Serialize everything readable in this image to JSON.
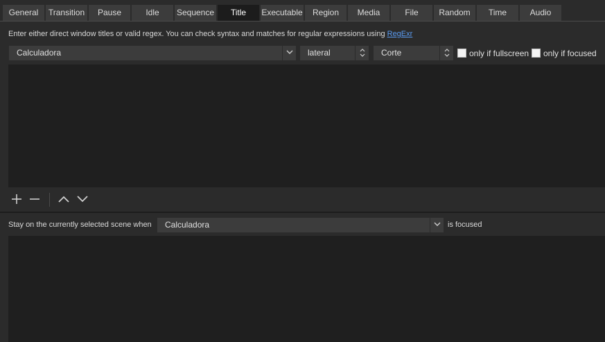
{
  "tabs": [
    "General",
    "Transition",
    "Pause",
    "Idle",
    "Sequence",
    "Title",
    "Executable",
    "Region",
    "Media",
    "File",
    "Random",
    "Time",
    "Audio"
  ],
  "active_tab": "Title",
  "description": {
    "text": "Enter either direct window titles or valid regex. You can check syntax and matches for regular expressions using ",
    "link": "RegExr"
  },
  "window_select": {
    "value": "Calculadora"
  },
  "scene_spin": {
    "value": "lateral"
  },
  "transition_spin": {
    "value": "Corte"
  },
  "checkboxes": {
    "fullscreen": {
      "label": "only if fullscreen",
      "checked": false
    },
    "focused": {
      "label": "only if focused",
      "checked": false
    }
  },
  "toolbar": {
    "add": "plus-icon",
    "remove": "minus-icon",
    "up": "chevron-up-icon",
    "down": "chevron-down-icon"
  },
  "stay": {
    "prefix": "Stay on the currently selected scene when",
    "window_value": "Calculadora",
    "suffix": "is focused"
  },
  "colors": {
    "background": "#2b2b2b",
    "list_background": "#1f1f1f",
    "control": "#3c3c3c",
    "active_tab": "#1c1c1c",
    "link": "#5a9bf2"
  }
}
